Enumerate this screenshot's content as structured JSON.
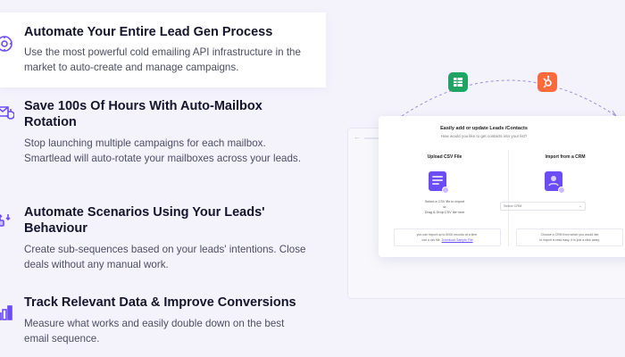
{
  "features": [
    {
      "title": "Automate Your Entire Lead Gen Process",
      "description": "Use the most powerful cold emailing API infrastructure in the market to auto-create and manage campaigns.",
      "icon": "gear-sync-icon",
      "active": true
    },
    {
      "title": "Save 100s Of Hours With Auto-Mailbox Rotation",
      "description": "Stop launching multiple campaigns for each mailbox. Smartlead will auto-rotate your mailboxes across your leads.",
      "icon": "mailbox-rotate-icon",
      "active": false
    },
    {
      "title": "Automate Scenarios Using Your Leads' Behaviour",
      "description": "Create sub-sequences based on your leads' intentions. Close deals without any manual work.",
      "icon": "scenario-icon",
      "active": false
    },
    {
      "title": "Track Relevant Data & Improve Conversions",
      "description": "Measure what works and easily double down on the best email sequence.",
      "icon": "analytics-icon",
      "active": false
    }
  ],
  "illustration": {
    "card_title": "Easily add or update Leads /Contacts",
    "card_subtitle": "How would you like to get contacts into your list?",
    "upload": {
      "title": "Upload CSV File",
      "line1": "Select a CSV file to import",
      "line2": "or",
      "line3": "Drag & Drop CSV file here",
      "note1": "you can import up to 5000 records at a time.",
      "note2_prefix": "use a csv file.",
      "note2_link": "Download Sample File"
    },
    "crm": {
      "title": "Import from a CRM",
      "select_value": "Select CRM",
      "note1": "Choose a CRM from which you would like",
      "note2": "to import is read easy. It is just a click away."
    },
    "colors": {
      "accent": "#6a4df4",
      "sheets": "#1fa463",
      "hubspot": "#ff6a3d"
    }
  }
}
